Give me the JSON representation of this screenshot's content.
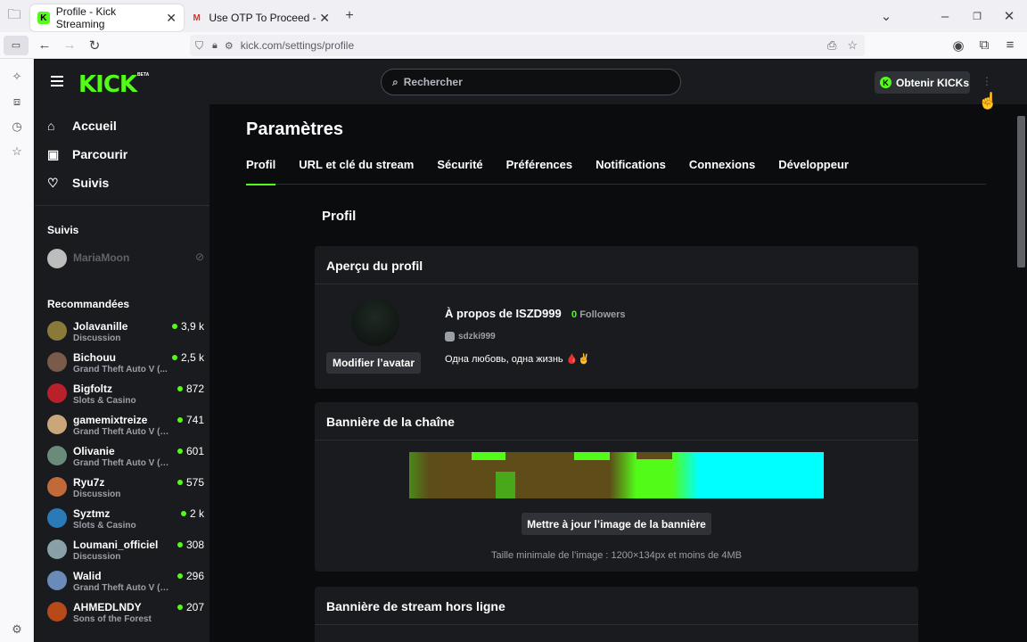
{
  "browser": {
    "tabs": [
      {
        "title": "Profile - Kick Streaming",
        "active": true
      },
      {
        "title": "Use OTP To Proceed - yassinebo",
        "active": false
      }
    ],
    "new_tab": "+",
    "url": "kick.com/settings/profile"
  },
  "header": {
    "logo": "KICK",
    "beta": "BETA",
    "search_placeholder": "Rechercher",
    "get_kicks": "Obtenir KICKs"
  },
  "sidebar": {
    "nav": [
      {
        "label": "Accueil",
        "icon": "home-icon"
      },
      {
        "label": "Parcourir",
        "icon": "browse-icon"
      },
      {
        "label": "Suivis",
        "icon": "heart-icon"
      }
    ],
    "following_title": "Suivis",
    "following": [
      {
        "name": "MariaMoon"
      }
    ],
    "recommended_title": "Recommandées",
    "recommended": [
      {
        "name": "Jolavanille",
        "category": "Discussion",
        "viewers": "3,9 k",
        "color": "#8a7a3a"
      },
      {
        "name": "Bichouu",
        "category": "Grand Theft Auto V (...",
        "viewers": "2,5 k",
        "color": "#7a5a4a"
      },
      {
        "name": "Bigfoltz",
        "category": "Slots & Casino",
        "viewers": "872",
        "color": "#b8202a"
      },
      {
        "name": "gamemixtreize",
        "category": "Grand Theft Auto V (G...",
        "viewers": "741",
        "color": "#c9a77a"
      },
      {
        "name": "Olivanie",
        "category": "Grand Theft Auto V (G...",
        "viewers": "601",
        "color": "#6a8a7a"
      },
      {
        "name": "Ryu7z",
        "category": "Discussion",
        "viewers": "575",
        "color": "#c06a3a"
      },
      {
        "name": "Syztmz",
        "category": "Slots & Casino",
        "viewers": "2 k",
        "color": "#2a7ab8"
      },
      {
        "name": "Loumani_officiel",
        "category": "Discussion",
        "viewers": "308",
        "color": "#8aa0a8"
      },
      {
        "name": "Walid",
        "category": "Grand Theft Auto V (G...",
        "viewers": "296",
        "color": "#6a8ab8"
      },
      {
        "name": "AHMEDLNDY",
        "category": "Sons of the Forest",
        "viewers": "207",
        "color": "#b84a1a"
      }
    ]
  },
  "main": {
    "title": "Paramètres",
    "tabs": [
      "Profil",
      "URL et clé du stream",
      "Sécurité",
      "Préférences",
      "Notifications",
      "Connexions",
      "Développeur"
    ],
    "section_title": "Profil",
    "profile_card": {
      "title": "Aperçu du profil",
      "about": "À propos de ISZD999",
      "followers_count": "0",
      "followers_label": "Followers",
      "handle": "sdzki999",
      "bio": "Одна любовь, одна жизнь 🩸✌️",
      "edit_avatar": "Modifier l’avatar"
    },
    "banner_card": {
      "title": "Bannière de la chaîne",
      "update_button": "Mettre à jour l’image de la bannière",
      "caption": "Taille minimale de l’image : 1200×134px et moins de 4MB"
    },
    "offline_card": {
      "title": "Bannière de stream hors ligne"
    }
  }
}
